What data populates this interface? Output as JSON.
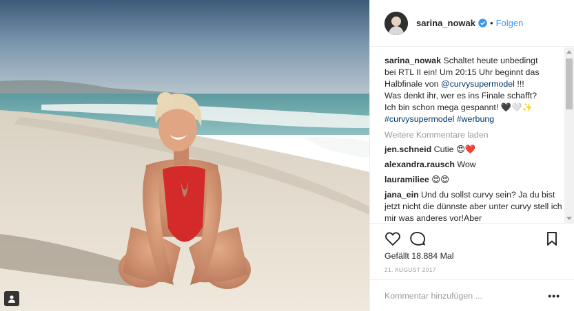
{
  "post": {
    "author": "sarina_nowak",
    "follow_separator": "•",
    "follow_label": "Folgen",
    "caption_lines": [
      "Schaltet heute unbedingt",
      "bei RTL II ein! Um 20:15 Uhr beginnt das",
      "Halbfinale von",
      "!!!",
      "Was denkt ihr, wer es ins Finale schafft?",
      "Ich bin schon mega gespannt! 🖤🤍✨"
    ],
    "mention": "@curvysupermodel",
    "hashtags": [
      "#curvysupermodel",
      "#werbung"
    ],
    "load_more": "Weitere Kommentare laden",
    "comments": [
      {
        "user": "jen.schneid",
        "text": "Cutie 😍❤️"
      },
      {
        "user": "alexandra.rausch",
        "text": "Wow"
      },
      {
        "user": "lauramiliee",
        "text": "😍😍"
      },
      {
        "user": "jana_ein",
        "text": "Und du sollst curvy sein? Ja du bist jetzt nicht die dünnste aber unter curvy stell ich mir was anderes vor!Aber"
      }
    ],
    "likes": "Gefällt 18.884 Mal",
    "date": "21. AUGUST 2017",
    "comment_placeholder": "Kommentar hinzufügen ...",
    "options": "•••"
  },
  "icons": {
    "verified": "verified-badge-icon",
    "like": "heart-icon",
    "comment": "comment-bubble-icon",
    "save": "bookmark-icon",
    "user_tags": "user-tag-icon"
  },
  "colors": {
    "link_blue": "#3897f0",
    "hashtag": "#003569",
    "muted": "#999999",
    "swimsuit_red": "#d42a2a"
  }
}
